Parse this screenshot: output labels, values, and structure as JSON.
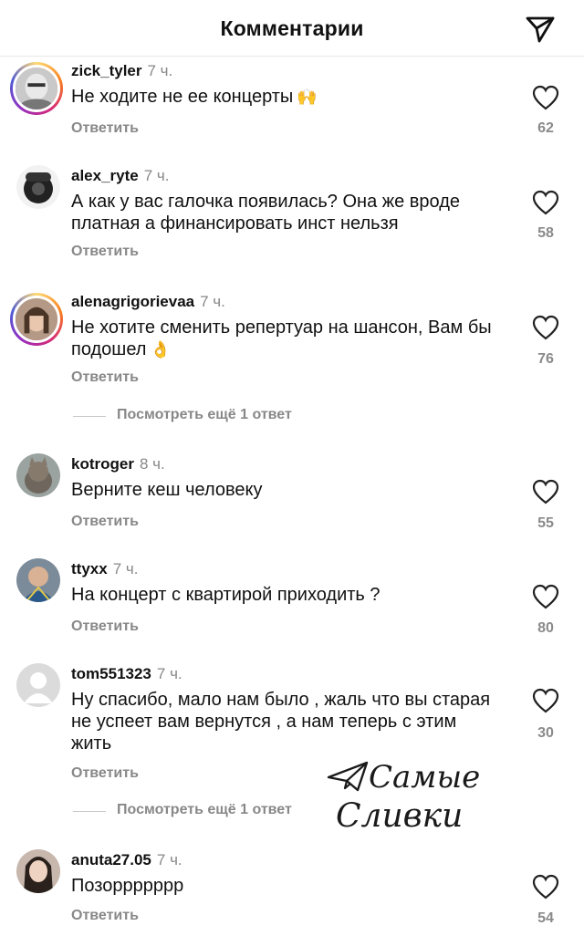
{
  "header": {
    "title": "Комментарии",
    "share_icon": "send-icon"
  },
  "reply_label": "Ответить",
  "comments": [
    {
      "username": "zick_tyler",
      "time": "7 ч.",
      "text": "Не ходите не ее концерты",
      "emoji": "🙌",
      "likes": "62",
      "story_ring": true
    },
    {
      "username": "alex_ryte",
      "time": "7 ч.",
      "text": "А как у вас галочка появилась? Она же вроде платная а финансировать инст нельзя",
      "emoji": "",
      "likes": "58",
      "story_ring": false
    },
    {
      "username": "alenagrigorievaa",
      "time": "7 ч.",
      "text": "Не хотите сменить репертуар на шансон, Вам бы подошел",
      "emoji": "👌",
      "likes": "76",
      "story_ring": true,
      "more_replies": "Посмотреть ещё 1 ответ"
    },
    {
      "username": "kotroger",
      "time": "8 ч.",
      "text": "Верните кеш человеку",
      "emoji": "",
      "likes": "55",
      "story_ring": false
    },
    {
      "username": "ttyxx",
      "time": "7 ч.",
      "text": "На концерт с квартирой приходить ?",
      "emoji": "",
      "likes": "80",
      "story_ring": false
    },
    {
      "username": "tom551323",
      "time": "7 ч.",
      "text": "Ну спасибо, мало нам было , жаль что вы старая не успеет вам вернутся , а нам теперь с этим жить",
      "emoji": "",
      "likes": "30",
      "story_ring": false,
      "more_replies": "Посмотреть ещё 1 ответ"
    },
    {
      "username": "anuta27.05",
      "time": "7 ч.",
      "text": "Позорррpppp",
      "emoji": "",
      "likes": "54",
      "story_ring": false
    }
  ],
  "watermark": {
    "line1": "Самые",
    "line2": "Сливки"
  }
}
